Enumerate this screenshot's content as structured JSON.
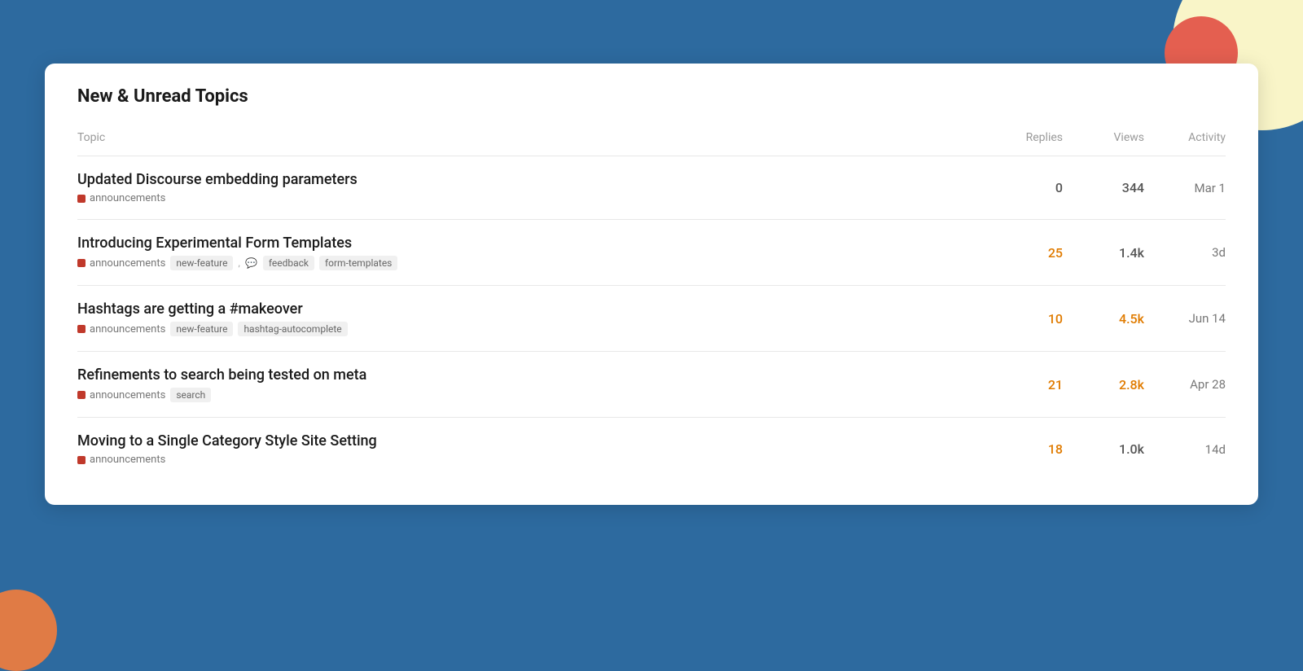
{
  "background": {
    "color": "#2d6a9f"
  },
  "panel": {
    "title": "New & Unread Topics"
  },
  "table": {
    "headers": {
      "topic": "Topic",
      "replies": "Replies",
      "views": "Views",
      "activity": "Activity"
    },
    "rows": [
      {
        "id": 1,
        "title": "Updated Discourse embedding parameters",
        "category": "announcements",
        "tags": [],
        "replies": "0",
        "replies_hot": false,
        "views": "344",
        "views_hot": false,
        "activity": "Mar 1"
      },
      {
        "id": 2,
        "title": "Introducing Experimental Form Templates",
        "category": "announcements",
        "tags": [
          "new-feature",
          "feedback",
          "form-templates"
        ],
        "tag_icon_index": 1,
        "replies": "25",
        "replies_hot": true,
        "views": "1.4k",
        "views_hot": false,
        "activity": "3d"
      },
      {
        "id": 3,
        "title": "Hashtags are getting a #makeover",
        "category": "announcements",
        "tags": [
          "new-feature",
          "hashtag-autocomplete"
        ],
        "replies": "10",
        "replies_hot": true,
        "views": "4.5k",
        "views_hot": true,
        "activity": "Jun 14"
      },
      {
        "id": 4,
        "title": "Refinements to search being tested on meta",
        "category": "announcements",
        "tags": [
          "search"
        ],
        "replies": "21",
        "replies_hot": true,
        "views": "2.8k",
        "views_hot": true,
        "activity": "Apr 28"
      },
      {
        "id": 5,
        "title": "Moving to a Single Category Style Site Setting",
        "category": "announcements",
        "tags": [],
        "replies": "18",
        "replies_hot": true,
        "views": "1.0k",
        "views_hot": false,
        "activity": "14d"
      }
    ]
  }
}
